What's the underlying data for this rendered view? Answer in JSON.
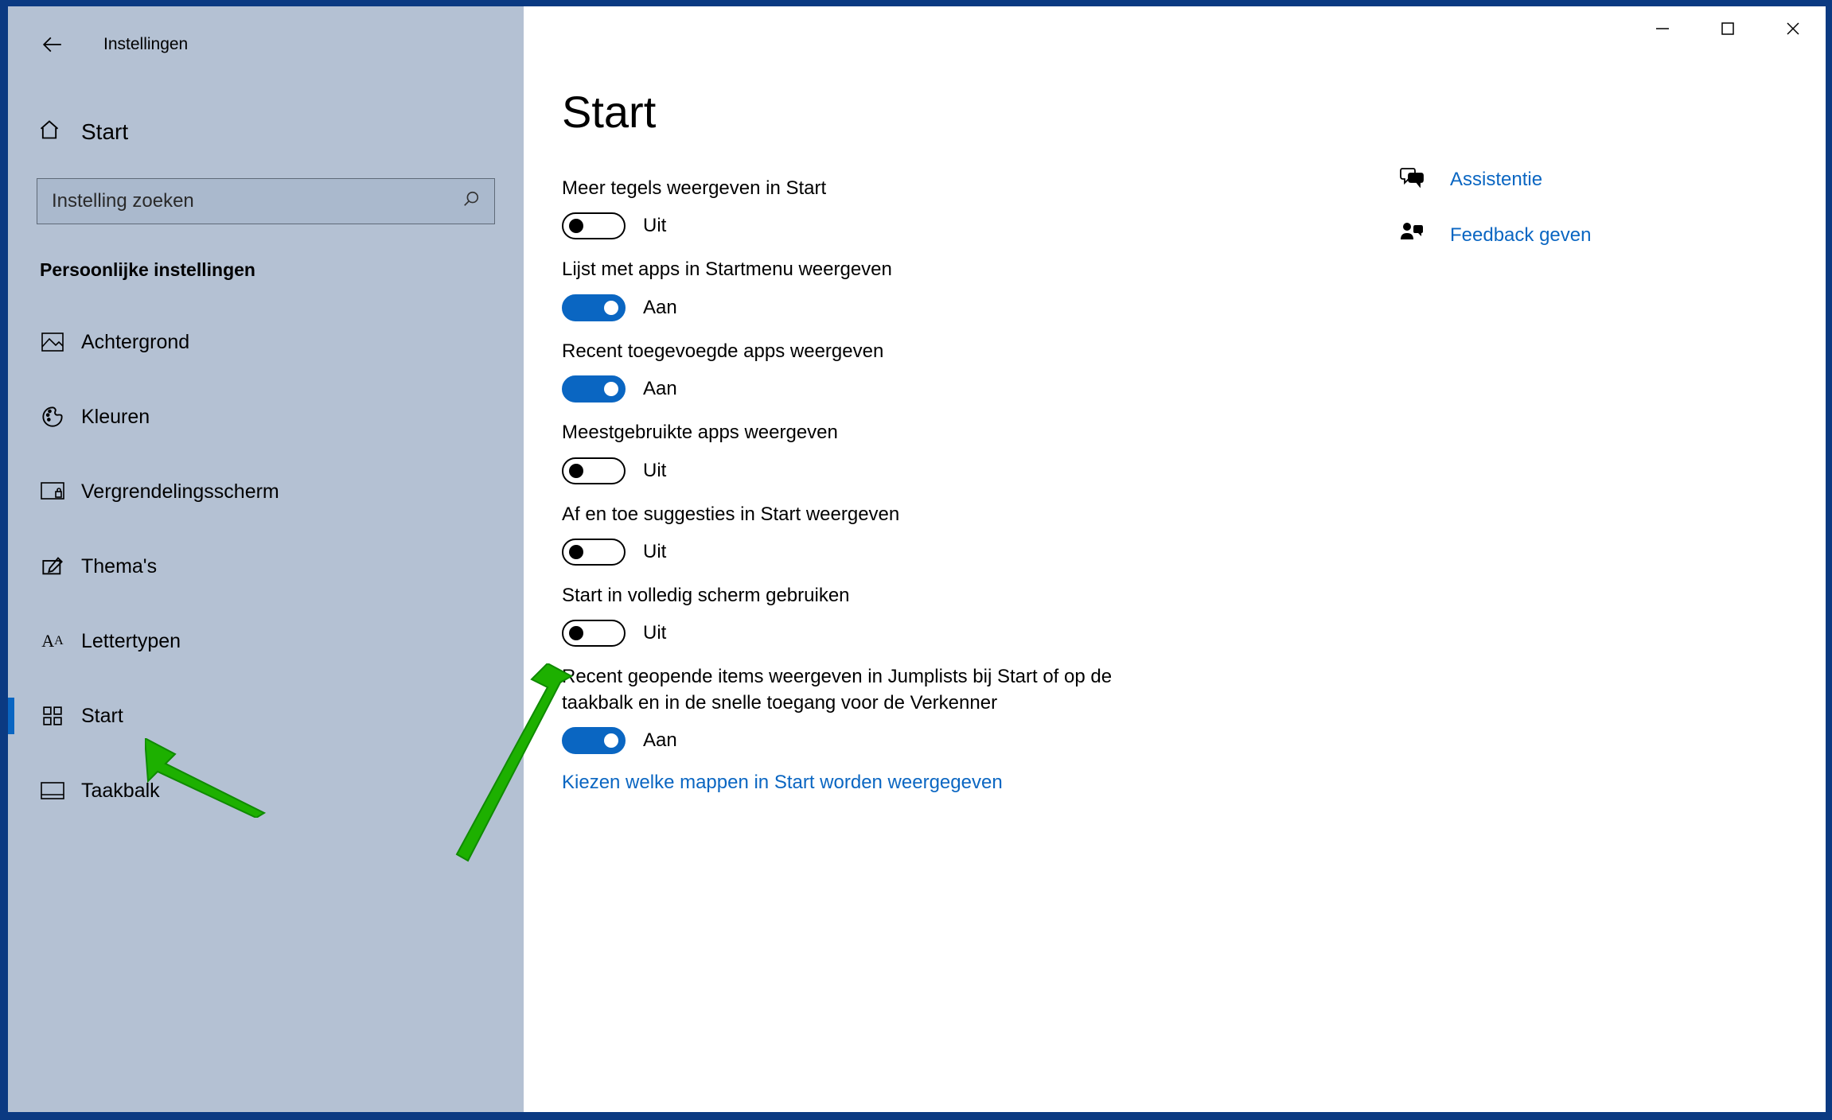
{
  "window_title": "Instellingen",
  "home_label": "Start",
  "search_placeholder": "Instelling zoeken",
  "category": "Persoonlijke instellingen",
  "nav": {
    "items": [
      {
        "label": "Achtergrond"
      },
      {
        "label": "Kleuren"
      },
      {
        "label": "Vergrendelingsscherm"
      },
      {
        "label": "Thema's"
      },
      {
        "label": "Lettertypen"
      },
      {
        "label": "Start"
      },
      {
        "label": "Taakbalk"
      }
    ]
  },
  "page_title": "Start",
  "toggle_on_text": "Aan",
  "toggle_off_text": "Uit",
  "settings": [
    {
      "label": "Meer tegels weergeven in Start",
      "on": false
    },
    {
      "label": "Lijst met apps in Startmenu weergeven",
      "on": true
    },
    {
      "label": "Recent toegevoegde apps weergeven",
      "on": true
    },
    {
      "label": "Meestgebruikte apps weergeven",
      "on": false
    },
    {
      "label": "Af en toe suggesties in Start weergeven",
      "on": false
    },
    {
      "label": "Start in volledig scherm gebruiken",
      "on": false
    },
    {
      "label": "Recent geopende items weergeven in Jumplists bij Start of op de taakbalk en in de snelle toegang voor de Verkenner",
      "on": true
    }
  ],
  "link_choose_folders": "Kiezen welke mappen in Start worden weergegeven",
  "help": {
    "assistance": "Assistentie",
    "feedback": "Feedback geven"
  }
}
